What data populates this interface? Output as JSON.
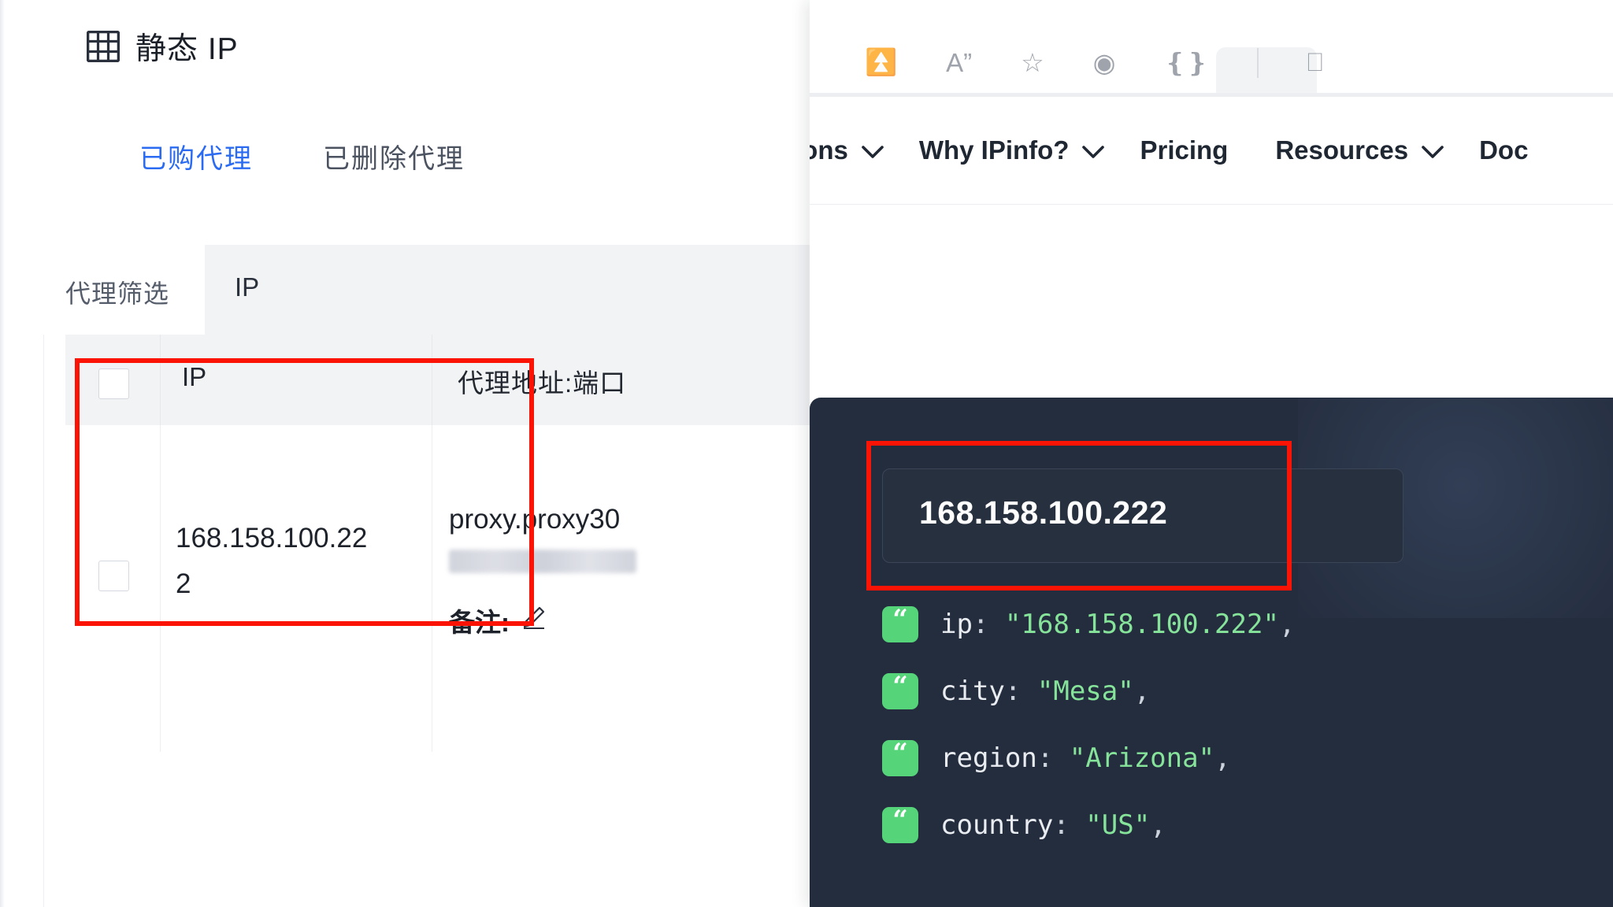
{
  "proxy_app": {
    "header": {
      "icon": "grid-icon",
      "title": "静态 IP"
    },
    "tabs": [
      {
        "label": "已购代理",
        "active": true
      },
      {
        "label": "已删除代理",
        "active": false
      }
    ],
    "filter": {
      "label": "代理筛选",
      "select_value": "IP",
      "select_icon": "chevron-down-icon"
    },
    "table": {
      "headers": [
        "",
        "IP",
        "代理地址:端口"
      ],
      "rows": [
        {
          "checked": false,
          "ip": "168.158.100.222",
          "proxy_address": "proxy.proxy30",
          "masked_value": "",
          "note_label": "备注:",
          "note_edit_icon": "pencil-icon"
        }
      ]
    }
  },
  "browser": {
    "toolbar_icons": [
      "read-aloud-icon",
      "font-size-icon",
      "favorites-icon",
      "collections-icon",
      "browser-essentials-icon",
      "split-screen-icon"
    ],
    "nav_items": [
      {
        "label": "tions",
        "has_caret": true
      },
      {
        "label": "Why IPinfo?",
        "has_caret": true
      },
      {
        "label": "Pricing",
        "has_caret": false
      },
      {
        "label": "Resources",
        "has_caret": true
      },
      {
        "label": "Doc",
        "has_caret": false
      }
    ]
  },
  "ipinfo_panel": {
    "search_value": "168.158.100.222",
    "results": [
      {
        "key": "ip",
        "value": "168.158.100.222"
      },
      {
        "key": "city",
        "value": "Mesa"
      },
      {
        "key": "region",
        "value": "Arizona"
      },
      {
        "key": "country",
        "value": "US"
      }
    ],
    "punct": {
      "colon": ":",
      "quote": "\"",
      "comma": ","
    }
  },
  "annotations": {
    "highlight_color": "#fb1405",
    "boxes": [
      "ip-column-highlight",
      "ip-search-highlight"
    ]
  }
}
